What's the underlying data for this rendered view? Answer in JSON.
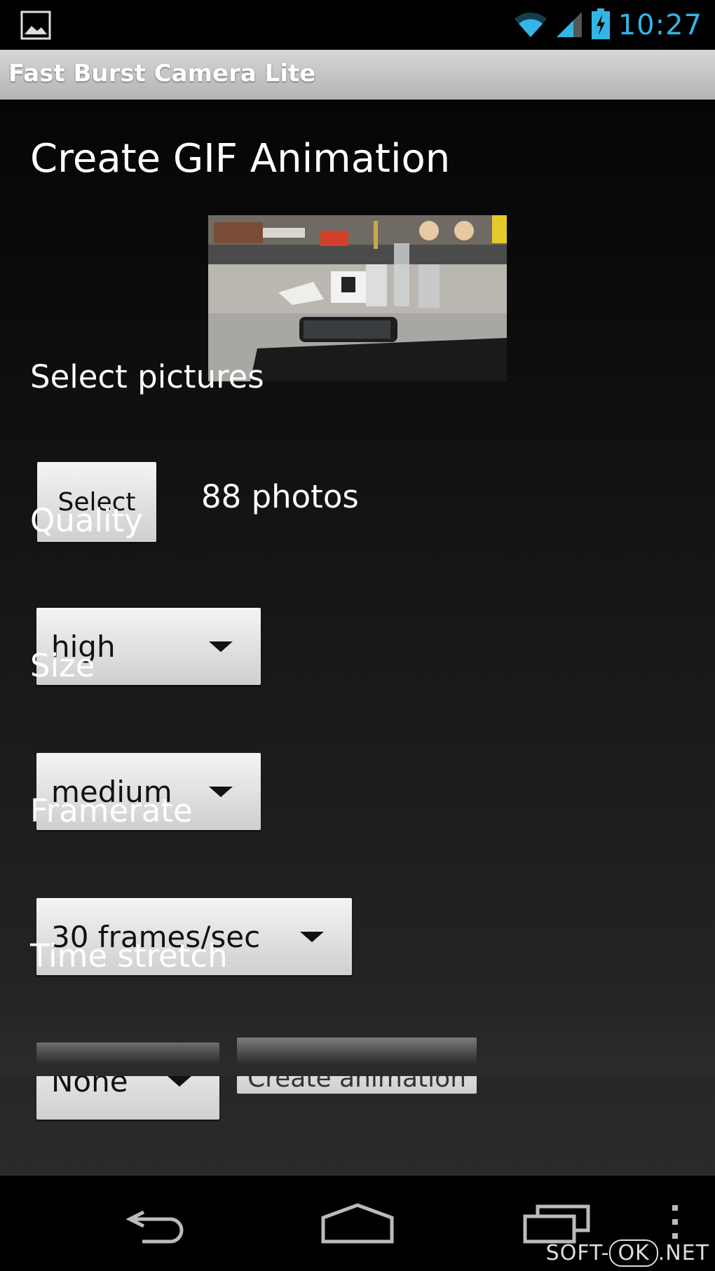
{
  "status_bar": {
    "time": "10:27",
    "icons": [
      "gallery-icon",
      "wifi-icon",
      "signal-icon",
      "battery-charging-icon"
    ],
    "accent_color": "#33b5e5"
  },
  "action_bar": {
    "title": "Fast Burst Camera Lite"
  },
  "screen": {
    "heading": "Create GIF Animation",
    "preview_image": "desk-photo-thumbnail",
    "select_pictures": {
      "label": "Select pictures",
      "button": "Select",
      "count": "88 photos"
    },
    "quality": {
      "label": "Quality",
      "value": "high"
    },
    "size": {
      "label": "Size",
      "value": "medium"
    },
    "framerate": {
      "label": "Framerate",
      "value": "30 frames/sec"
    },
    "time_stretch": {
      "label": "Time stretch",
      "value": "None"
    },
    "create_button": "Create animation"
  },
  "nav_bar": {
    "icons": [
      "back-icon",
      "home-icon",
      "recent-apps-icon",
      "overflow-menu-icon"
    ]
  },
  "watermark": {
    "left": "SOFT-",
    "middle": "OK",
    "right": ".NET"
  }
}
